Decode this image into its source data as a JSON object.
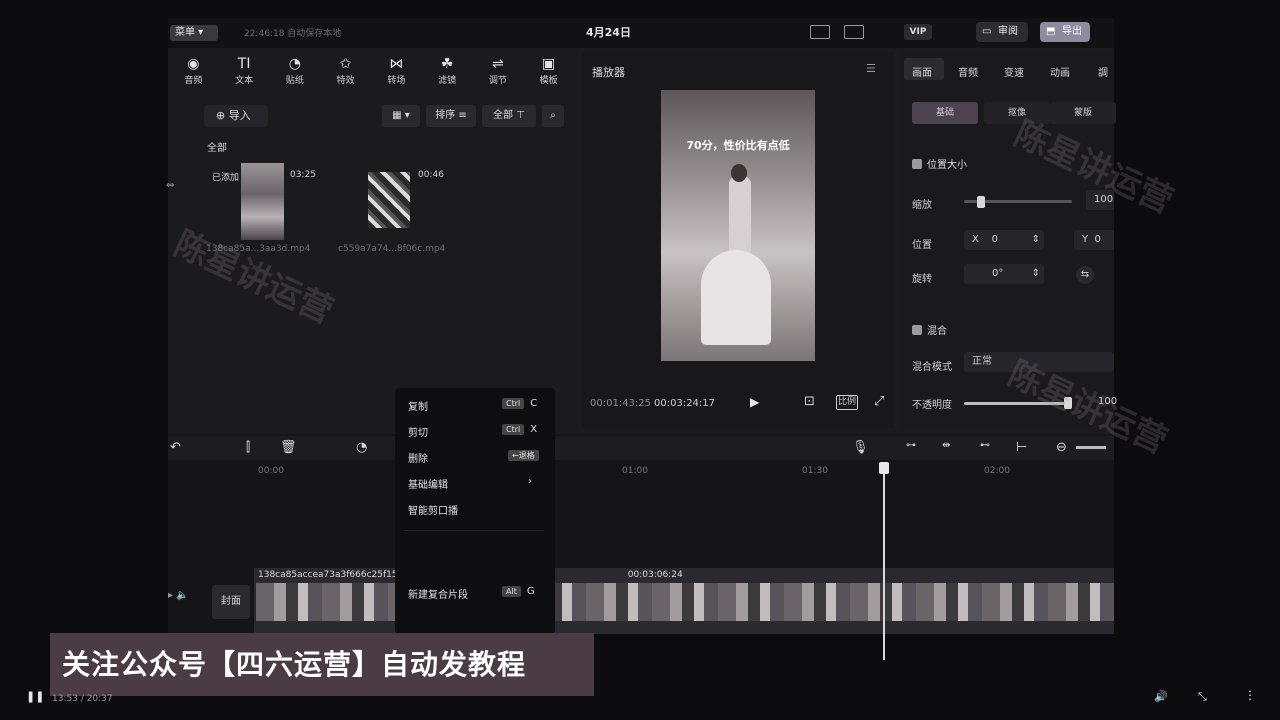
{
  "header": {
    "menu_label": "菜单",
    "autosave": "22:46:18 自动保存本地",
    "project_title": "4月24日",
    "vip_label": "VIP",
    "review_label": "审阅",
    "export_label": "导出"
  },
  "tools": [
    {
      "label": "音频",
      "icon": "audio-icon"
    },
    {
      "label": "文本",
      "icon": "text-icon"
    },
    {
      "label": "贴纸",
      "icon": "sticker-icon"
    },
    {
      "label": "特效",
      "icon": "effect-icon"
    },
    {
      "label": "转场",
      "icon": "transition-icon"
    },
    {
      "label": "滤镜",
      "icon": "filter-icon"
    },
    {
      "label": "调节",
      "icon": "adjust-icon"
    },
    {
      "label": "模板",
      "icon": "template-icon"
    }
  ],
  "media": {
    "import_label": "导入",
    "sort_label": "排序",
    "filter_label": "全部",
    "section_label": "全部",
    "items": [
      {
        "tag": "已添加",
        "duration": "03:25",
        "filename": "138ca85a...3aa3d.mp4"
      },
      {
        "tag": "",
        "duration": "00:46",
        "filename": "c559a7a74...8f06c.mp4"
      }
    ]
  },
  "player": {
    "title": "播放器",
    "caption": "70分，性价比有点低",
    "current_time": "00:01:43:25",
    "total_time": "00:03:24:17",
    "ratio_label": "比例"
  },
  "properties": {
    "tabs": [
      "画面",
      "音频",
      "变速",
      "动画",
      "調"
    ],
    "subtabs": [
      "基础",
      "抠像",
      "蒙版"
    ],
    "position_section": "位置大小",
    "scale_label": "缩放",
    "scale_value": "100",
    "scale_level": 0.12,
    "position_label": "位置",
    "x_label": "X",
    "x_value": "0",
    "y_label": "Y",
    "y_value": "0",
    "rotation_label": "旋转",
    "rotation_value": "0°",
    "blend_section": "混合",
    "blend_mode_label": "混合模式",
    "blend_mode_value": "正常",
    "opacity_label": "不透明度",
    "opacity_value": "100",
    "opacity_level": 0.98
  },
  "timeline": {
    "ruler": [
      "00:00",
      "01:00",
      "01:30",
      "02:00"
    ],
    "cover_label": "封面",
    "clip_title": "138ca85accea73a3f666c25f151aa3d.mp4",
    "clip_duration": "00:03:06:24"
  },
  "context_menu": {
    "items": [
      {
        "label": "复制",
        "key": "Ctrl",
        "letter": "C"
      },
      {
        "label": "剪切",
        "key": "Ctrl",
        "letter": "X"
      },
      {
        "label": "删除",
        "key": "←退格",
        "letter": ""
      },
      {
        "label": "基础编辑",
        "key": "",
        "letter": "›"
      },
      {
        "label": "智能剪口播",
        "key": "",
        "letter": ""
      },
      {
        "label": "新建复合片段",
        "key": "Alt",
        "letter": "G"
      }
    ]
  },
  "banner": "关注公众号【四六运营】自动发教程",
  "watermark": "陈星讲运营",
  "bottom": {
    "time": "13:53 / 20:37"
  }
}
